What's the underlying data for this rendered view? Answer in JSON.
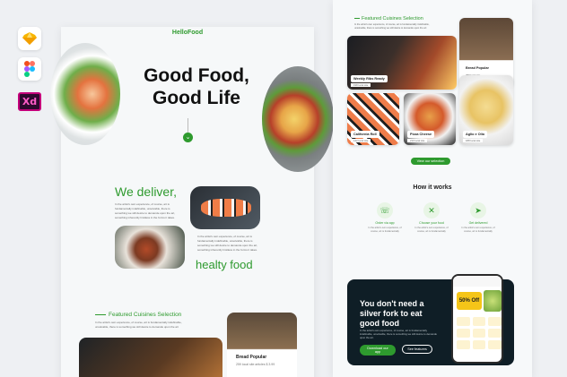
{
  "tools": {
    "sketch_icon": "sketch-icon",
    "figma_icon": "figma-icon",
    "xd_label": "Xd"
  },
  "left": {
    "brand": "HelloFood",
    "hero_line1": "Good Food,",
    "hero_line2": "Good Life",
    "deliver": "We deliver,",
    "healty": "healty food",
    "deliver_text": "In the artist's own experience, of course, art is fundamentally indefinable, unsolvable, there is something we still desire to demande upon the art, something inherently limitless in the forms it takes.",
    "healty_text": "In the artist's own experience, of course, art is fundamentally indefinable, unsolvable, there is something we still desire to demande upon the art, something inherently limitless in the forms it takes.",
    "featured_title": "Featured Cuisines Selection",
    "featured_text": "In the artist's own experience, of course, art is fundamentally indefinable, unsolvable, there is something we still desire to demande upon the art",
    "bread_label": "Bread Popular",
    "bread_meta": "259 local site articles   $ 3.99"
  },
  "right": {
    "featured_title": "Featured Cuisines Selection",
    "featured_text": "In the artist's own experience, of course, art is fundamentally indefinable, unsolvable, there is something we still desire to demande upon the art",
    "cards": [
      {
        "label": "Weekly Ribs Ready",
        "meta": "198 local site"
      },
      {
        "label": "Bread Popular",
        "meta": "259 local site"
      },
      {
        "label": "California Roll",
        "meta": "142 local site"
      },
      {
        "label": "Pizza Cheese",
        "meta": "210 local site"
      },
      {
        "label": "Aglio e Olio",
        "meta": "188 local site"
      }
    ],
    "view_more": "View our selection",
    "how_title": "How it works",
    "steps": [
      {
        "icon": "phone-icon",
        "title": "Order via app",
        "desc": "In the artist's own experience, of course, art is fundamentally"
      },
      {
        "icon": "fork-knife-icon",
        "title": "Choose your food",
        "desc": "In the artist's own experience, of course, art is fundamentally"
      },
      {
        "icon": "delivery-icon",
        "title": "Get delivered",
        "desc": "In the artist's own experience, of course, art is fundamentally"
      }
    ],
    "promo_title": "You don't need a silver fork to eat good food",
    "promo_text": "In the artist's own experience, of course, art is fundamentally indefinable, unsolvable, there is something we still desire to demande upon the art.",
    "download": "Download our app",
    "see_features": "See features",
    "phone_offer": "50% Off"
  },
  "colors": {
    "accent": "#2e9a2e",
    "dark": "#0f1e26"
  }
}
